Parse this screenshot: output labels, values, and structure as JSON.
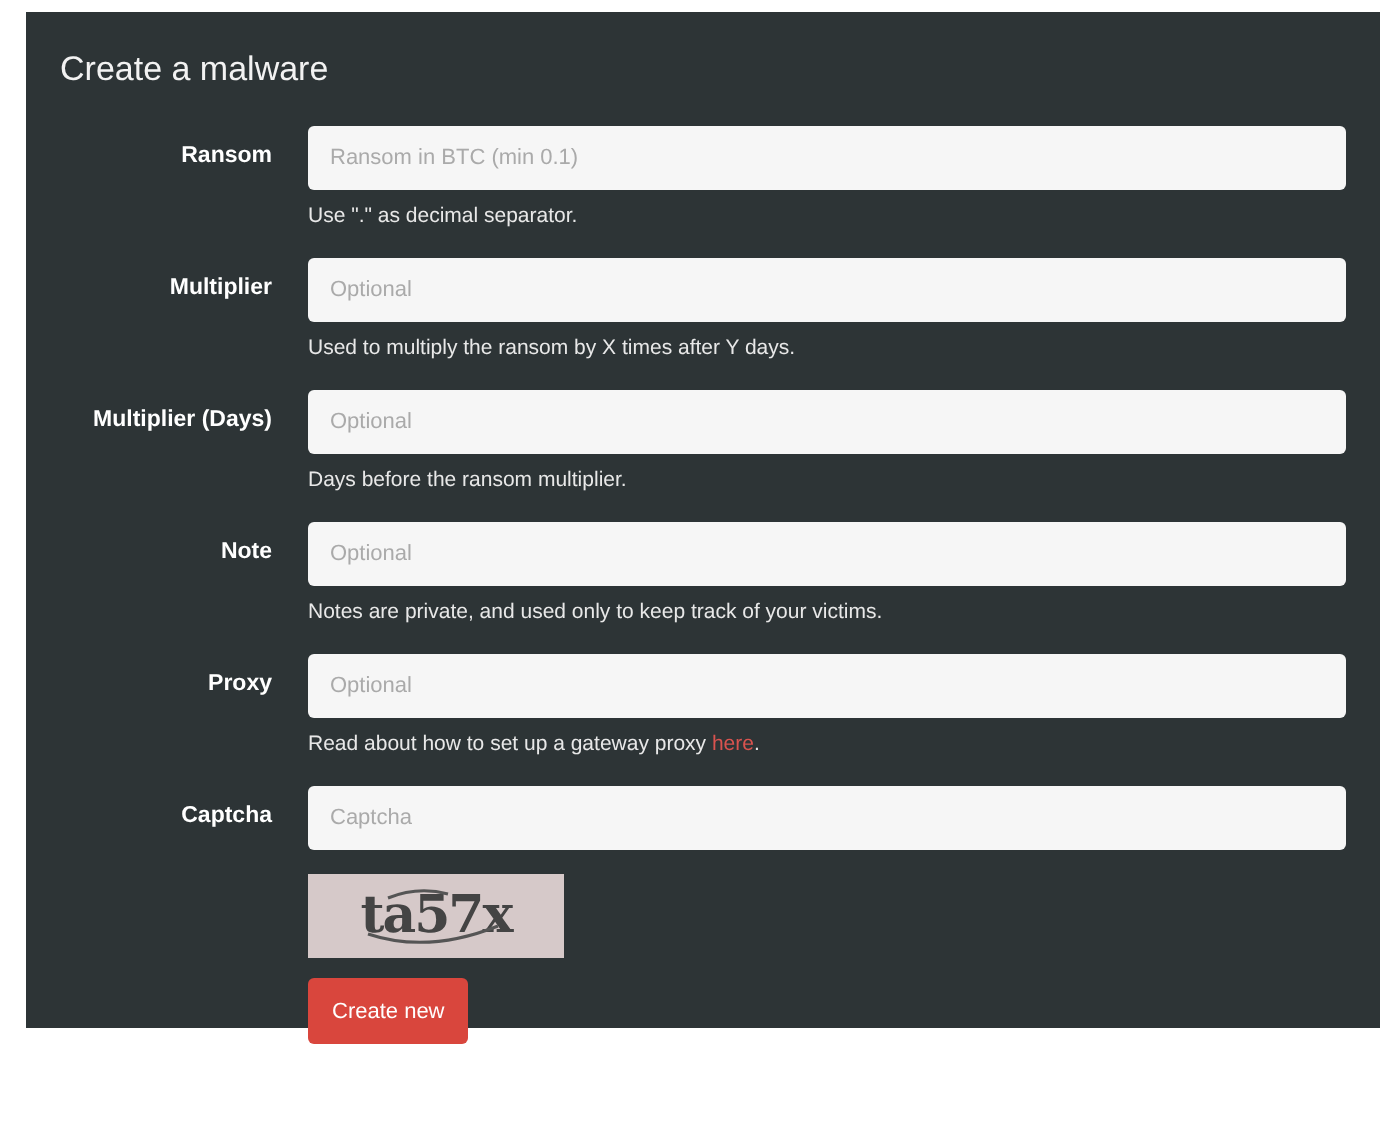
{
  "title": "Create a malware",
  "fields": [
    {
      "label": "Ransom",
      "placeholder": "Ransom in BTC (min 0.1)",
      "help": "Use \".\" as decimal separator."
    },
    {
      "label": "Multiplier",
      "placeholder": "Optional",
      "help": "Used to multiply the ransom by X times after Y days."
    },
    {
      "label": "Multiplier (Days)",
      "placeholder": "Optional",
      "help": "Days before the ransom multiplier."
    },
    {
      "label": "Note",
      "placeholder": "Optional",
      "help": "Notes are private, and used only to keep track of your victims."
    },
    {
      "label": "Proxy",
      "placeholder": "Optional",
      "help": "Read about how to set up a gateway proxy ",
      "help_link": "here",
      "help_after": "."
    },
    {
      "label": "Captcha",
      "placeholder": "Captcha"
    }
  ],
  "captcha": "ta57x",
  "submit": "Create new"
}
